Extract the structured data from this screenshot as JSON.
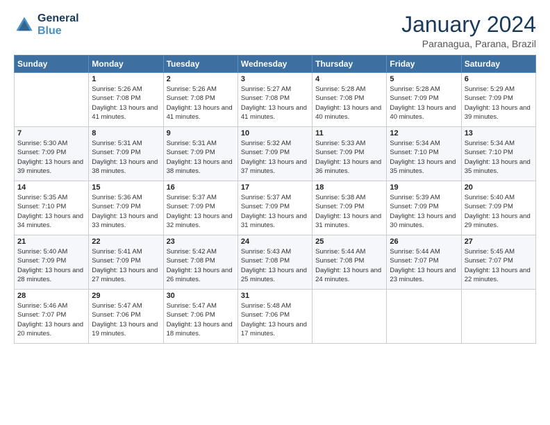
{
  "logo": {
    "line1": "General",
    "line2": "Blue"
  },
  "title": "January 2024",
  "subtitle": "Paranagua, Parana, Brazil",
  "weekdays": [
    "Sunday",
    "Monday",
    "Tuesday",
    "Wednesday",
    "Thursday",
    "Friday",
    "Saturday"
  ],
  "weeks": [
    [
      {
        "day": "",
        "sunrise": "",
        "sunset": "",
        "daylight": ""
      },
      {
        "day": "1",
        "sunrise": "Sunrise: 5:26 AM",
        "sunset": "Sunset: 7:08 PM",
        "daylight": "Daylight: 13 hours and 41 minutes."
      },
      {
        "day": "2",
        "sunrise": "Sunrise: 5:26 AM",
        "sunset": "Sunset: 7:08 PM",
        "daylight": "Daylight: 13 hours and 41 minutes."
      },
      {
        "day": "3",
        "sunrise": "Sunrise: 5:27 AM",
        "sunset": "Sunset: 7:08 PM",
        "daylight": "Daylight: 13 hours and 41 minutes."
      },
      {
        "day": "4",
        "sunrise": "Sunrise: 5:28 AM",
        "sunset": "Sunset: 7:08 PM",
        "daylight": "Daylight: 13 hours and 40 minutes."
      },
      {
        "day": "5",
        "sunrise": "Sunrise: 5:28 AM",
        "sunset": "Sunset: 7:09 PM",
        "daylight": "Daylight: 13 hours and 40 minutes."
      },
      {
        "day": "6",
        "sunrise": "Sunrise: 5:29 AM",
        "sunset": "Sunset: 7:09 PM",
        "daylight": "Daylight: 13 hours and 39 minutes."
      }
    ],
    [
      {
        "day": "7",
        "sunrise": "Sunrise: 5:30 AM",
        "sunset": "Sunset: 7:09 PM",
        "daylight": "Daylight: 13 hours and 39 minutes."
      },
      {
        "day": "8",
        "sunrise": "Sunrise: 5:31 AM",
        "sunset": "Sunset: 7:09 PM",
        "daylight": "Daylight: 13 hours and 38 minutes."
      },
      {
        "day": "9",
        "sunrise": "Sunrise: 5:31 AM",
        "sunset": "Sunset: 7:09 PM",
        "daylight": "Daylight: 13 hours and 38 minutes."
      },
      {
        "day": "10",
        "sunrise": "Sunrise: 5:32 AM",
        "sunset": "Sunset: 7:09 PM",
        "daylight": "Daylight: 13 hours and 37 minutes."
      },
      {
        "day": "11",
        "sunrise": "Sunrise: 5:33 AM",
        "sunset": "Sunset: 7:09 PM",
        "daylight": "Daylight: 13 hours and 36 minutes."
      },
      {
        "day": "12",
        "sunrise": "Sunrise: 5:34 AM",
        "sunset": "Sunset: 7:10 PM",
        "daylight": "Daylight: 13 hours and 35 minutes."
      },
      {
        "day": "13",
        "sunrise": "Sunrise: 5:34 AM",
        "sunset": "Sunset: 7:10 PM",
        "daylight": "Daylight: 13 hours and 35 minutes."
      }
    ],
    [
      {
        "day": "14",
        "sunrise": "Sunrise: 5:35 AM",
        "sunset": "Sunset: 7:10 PM",
        "daylight": "Daylight: 13 hours and 34 minutes."
      },
      {
        "day": "15",
        "sunrise": "Sunrise: 5:36 AM",
        "sunset": "Sunset: 7:09 PM",
        "daylight": "Daylight: 13 hours and 33 minutes."
      },
      {
        "day": "16",
        "sunrise": "Sunrise: 5:37 AM",
        "sunset": "Sunset: 7:09 PM",
        "daylight": "Daylight: 13 hours and 32 minutes."
      },
      {
        "day": "17",
        "sunrise": "Sunrise: 5:37 AM",
        "sunset": "Sunset: 7:09 PM",
        "daylight": "Daylight: 13 hours and 31 minutes."
      },
      {
        "day": "18",
        "sunrise": "Sunrise: 5:38 AM",
        "sunset": "Sunset: 7:09 PM",
        "daylight": "Daylight: 13 hours and 31 minutes."
      },
      {
        "day": "19",
        "sunrise": "Sunrise: 5:39 AM",
        "sunset": "Sunset: 7:09 PM",
        "daylight": "Daylight: 13 hours and 30 minutes."
      },
      {
        "day": "20",
        "sunrise": "Sunrise: 5:40 AM",
        "sunset": "Sunset: 7:09 PM",
        "daylight": "Daylight: 13 hours and 29 minutes."
      }
    ],
    [
      {
        "day": "21",
        "sunrise": "Sunrise: 5:40 AM",
        "sunset": "Sunset: 7:09 PM",
        "daylight": "Daylight: 13 hours and 28 minutes."
      },
      {
        "day": "22",
        "sunrise": "Sunrise: 5:41 AM",
        "sunset": "Sunset: 7:09 PM",
        "daylight": "Daylight: 13 hours and 27 minutes."
      },
      {
        "day": "23",
        "sunrise": "Sunrise: 5:42 AM",
        "sunset": "Sunset: 7:08 PM",
        "daylight": "Daylight: 13 hours and 26 minutes."
      },
      {
        "day": "24",
        "sunrise": "Sunrise: 5:43 AM",
        "sunset": "Sunset: 7:08 PM",
        "daylight": "Daylight: 13 hours and 25 minutes."
      },
      {
        "day": "25",
        "sunrise": "Sunrise: 5:44 AM",
        "sunset": "Sunset: 7:08 PM",
        "daylight": "Daylight: 13 hours and 24 minutes."
      },
      {
        "day": "26",
        "sunrise": "Sunrise: 5:44 AM",
        "sunset": "Sunset: 7:07 PM",
        "daylight": "Daylight: 13 hours and 23 minutes."
      },
      {
        "day": "27",
        "sunrise": "Sunrise: 5:45 AM",
        "sunset": "Sunset: 7:07 PM",
        "daylight": "Daylight: 13 hours and 22 minutes."
      }
    ],
    [
      {
        "day": "28",
        "sunrise": "Sunrise: 5:46 AM",
        "sunset": "Sunset: 7:07 PM",
        "daylight": "Daylight: 13 hours and 20 minutes."
      },
      {
        "day": "29",
        "sunrise": "Sunrise: 5:47 AM",
        "sunset": "Sunset: 7:06 PM",
        "daylight": "Daylight: 13 hours and 19 minutes."
      },
      {
        "day": "30",
        "sunrise": "Sunrise: 5:47 AM",
        "sunset": "Sunset: 7:06 PM",
        "daylight": "Daylight: 13 hours and 18 minutes."
      },
      {
        "day": "31",
        "sunrise": "Sunrise: 5:48 AM",
        "sunset": "Sunset: 7:06 PM",
        "daylight": "Daylight: 13 hours and 17 minutes."
      },
      {
        "day": "",
        "sunrise": "",
        "sunset": "",
        "daylight": ""
      },
      {
        "day": "",
        "sunrise": "",
        "sunset": "",
        "daylight": ""
      },
      {
        "day": "",
        "sunrise": "",
        "sunset": "",
        "daylight": ""
      }
    ]
  ]
}
